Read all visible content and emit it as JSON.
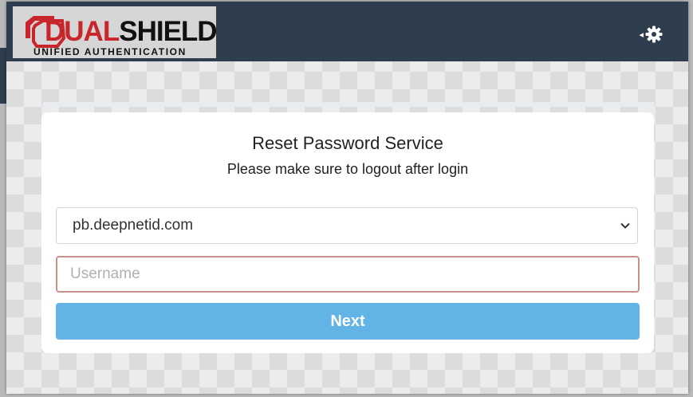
{
  "header": {
    "logo_word_part1": "DUAL",
    "logo_word_part2": "SHIELD",
    "logo_tagline": "UNIFIED AUTHENTICATION",
    "settings_icon": "gear-icon",
    "settings_caret_icon": "caret-left-icon"
  },
  "card": {
    "title": "Reset Password Service",
    "subtitle": "Please make sure to logout after login",
    "domain_select": {
      "selected": "pb.deepnetid.com",
      "icon": "chevron-down-icon"
    },
    "username": {
      "value": "",
      "placeholder": "Username"
    },
    "next_label": "Next"
  },
  "colors": {
    "topbar": "#2f3e4e",
    "brand_red": "#c8262c",
    "button": "#63b4e6",
    "input_border": "#c9908a"
  }
}
